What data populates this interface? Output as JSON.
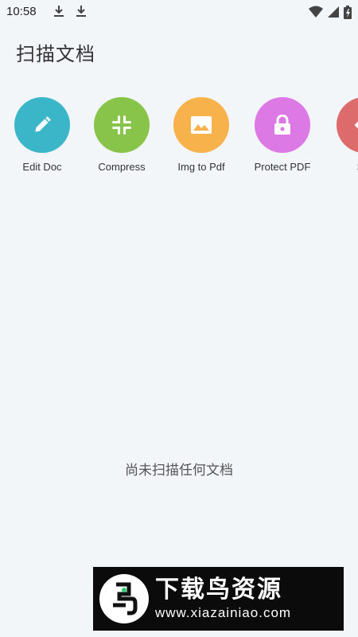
{
  "status": {
    "time": "10:58",
    "icons": [
      "download-icon",
      "download-icon",
      "wifi-icon",
      "signal-icon",
      "battery-icon"
    ]
  },
  "header": {
    "title": "扫描文档"
  },
  "tools": [
    {
      "label": "Edit Doc",
      "icon": "pencil-icon",
      "color": "#3bb6c9"
    },
    {
      "label": "Compress",
      "icon": "compress-icon",
      "color": "#88c34a"
    },
    {
      "label": "Img to Pdf",
      "icon": "image-icon",
      "color": "#f7b24c"
    },
    {
      "label": "Protect PDF",
      "icon": "lock-icon",
      "color": "#dc79e4"
    },
    {
      "label": "Spl",
      "icon": "split-icon",
      "color": "#dd6b6b"
    }
  ],
  "empty_state": {
    "text": "尚未扫描任何文档"
  },
  "watermark": {
    "title": "下载鸟资源",
    "url": "www.xiazainiao.com"
  }
}
